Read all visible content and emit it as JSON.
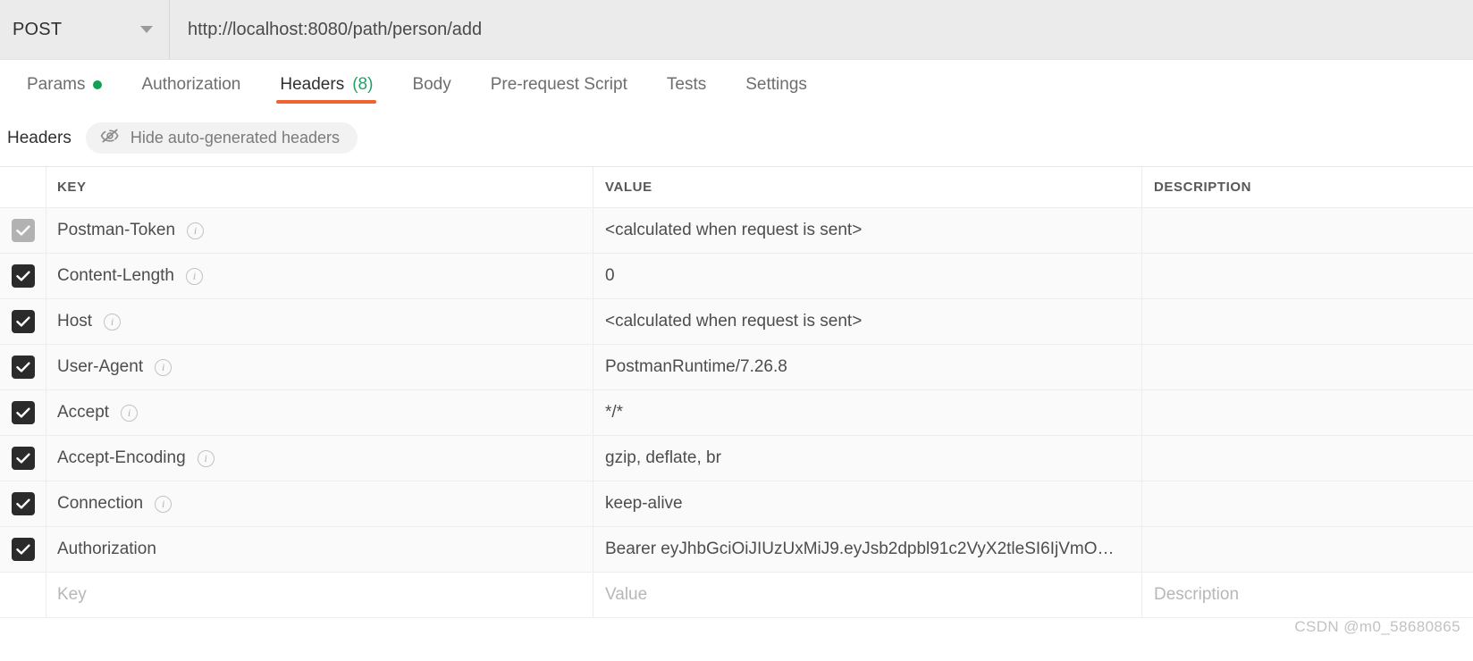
{
  "request": {
    "method": "POST",
    "method_caret_icon": "chevron-down-icon",
    "url": "http://localhost:8080/path/person/add"
  },
  "tabs": [
    {
      "label": "Params",
      "badge_dot": true,
      "active": false
    },
    {
      "label": "Authorization",
      "active": false
    },
    {
      "label": "Headers",
      "count": "(8)",
      "active": true
    },
    {
      "label": "Body",
      "active": false
    },
    {
      "label": "Pre-request Script",
      "active": false
    },
    {
      "label": "Tests",
      "active": false
    },
    {
      "label": "Settings",
      "active": false
    }
  ],
  "headers_toolbar": {
    "title": "Headers",
    "hide_label": "Hide auto-generated headers",
    "hide_icon": "eye-slash-icon"
  },
  "table": {
    "columns": {
      "key": "KEY",
      "value": "VALUE",
      "description": "DESCRIPTION"
    },
    "rows": [
      {
        "checked": true,
        "disabled": true,
        "info": true,
        "key": "Postman-Token",
        "value": "<calculated when request is sent>",
        "description": ""
      },
      {
        "checked": true,
        "disabled": false,
        "info": true,
        "key": "Content-Length",
        "value": "0",
        "description": ""
      },
      {
        "checked": true,
        "disabled": false,
        "info": true,
        "key": "Host",
        "value": "<calculated when request is sent>",
        "description": ""
      },
      {
        "checked": true,
        "disabled": false,
        "info": true,
        "key": "User-Agent",
        "value": "PostmanRuntime/7.26.8",
        "description": ""
      },
      {
        "checked": true,
        "disabled": false,
        "info": true,
        "key": "Accept",
        "value": "*/*",
        "description": ""
      },
      {
        "checked": true,
        "disabled": false,
        "info": true,
        "key": "Accept-Encoding",
        "value": "gzip, deflate, br",
        "description": ""
      },
      {
        "checked": true,
        "disabled": false,
        "info": true,
        "key": "Connection",
        "value": "keep-alive",
        "description": ""
      },
      {
        "checked": true,
        "disabled": false,
        "info": false,
        "key": "Authorization",
        "value": "Bearer eyJhbGciOiJIUzUxMiJ9.eyJsb2dpbl91c2VyX2tleSI6IjVmO…",
        "description": ""
      }
    ],
    "new_row": {
      "key": "Key",
      "value": "Value",
      "description": "Description"
    }
  },
  "watermark": "CSDN @m0_58680865",
  "colors": {
    "accent": "#ef6331",
    "count_green": "#21a366",
    "dot_green": "#12a150",
    "checkbox_on": "#2b2b2b",
    "checkbox_disabled": "#b2b2b2",
    "bar_bg": "#ebebeb"
  }
}
